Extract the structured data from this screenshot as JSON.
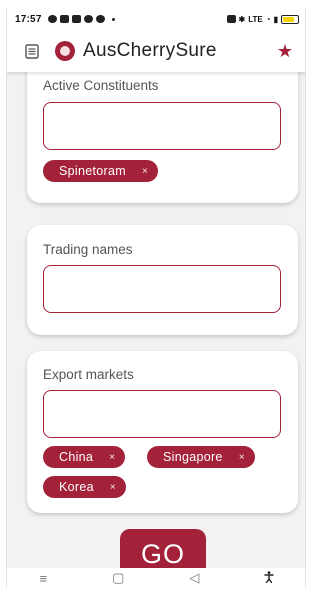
{
  "status": {
    "time": "17:57",
    "right_label": "LTE"
  },
  "appbar": {
    "title": "AusCherrySure",
    "menu_icon": "document-icon",
    "logo_icon": "cherry-logo",
    "favorite_icon": "star-icon"
  },
  "sections": {
    "active_constituents": {
      "label": "Active Constituents",
      "value": "",
      "chips": [
        "Spinetoram"
      ]
    },
    "trading_names": {
      "label": "Trading names",
      "value": ""
    },
    "export_markets": {
      "label": "Export markets",
      "value": "",
      "chips": [
        "China",
        "Singapore",
        "Korea"
      ]
    }
  },
  "chip_remove_glyph": "×",
  "go_label": "GO",
  "navbar": {
    "menu": "≡",
    "home": "▢",
    "back": "◁",
    "accessibility": "accessibility-icon"
  },
  "colors": {
    "accent": "#a3223a",
    "background": "#f3f1f1"
  }
}
